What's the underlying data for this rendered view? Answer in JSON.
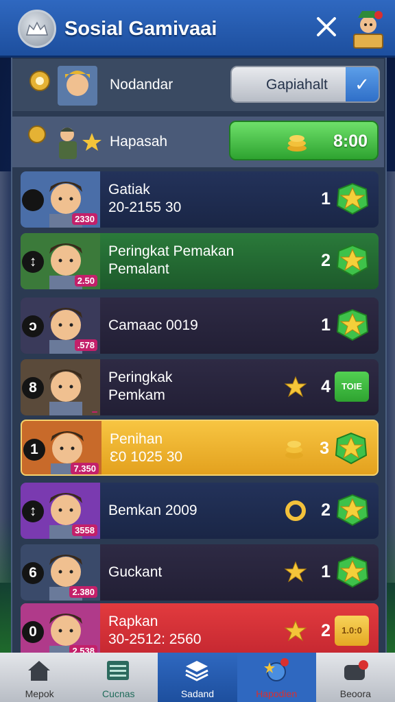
{
  "header": {
    "title": "Sosial Gamivaai"
  },
  "top_rows": [
    {
      "label": "Nodandar",
      "control_text": "Gapiahalt"
    },
    {
      "label": "Hapasah",
      "button_value": "8:00"
    }
  ],
  "rows": [
    {
      "name_line1": "Gatiak",
      "name_line2": "20-2155 30",
      "badge": "2330",
      "pos": "",
      "rank": "1",
      "style": "navy"
    },
    {
      "name_line1": "Peringkat Pemakan",
      "name_line2": "Pemalant",
      "badge": "2.50",
      "pos": "↕",
      "rank": "2",
      "style": "green"
    },
    {
      "name_line1": "Camaac 0019",
      "name_line2": "",
      "badge": ".578",
      "pos": "ↄ",
      "rank": "1",
      "style": "dark"
    },
    {
      "name_line1": "Peringkak",
      "name_line2": "Pemkam",
      "badge": "",
      "pos": "8",
      "rank": "4",
      "tag": "TOIE",
      "style": "dark"
    },
    {
      "name_line1": "Penihan",
      "name_line2": "Ɛ0 1025 30",
      "badge": "7.350",
      "pos": "1",
      "rank": "3",
      "style": "gold"
    },
    {
      "name_line1": "Bemkan 2009",
      "name_line2": "",
      "badge": "3558",
      "pos": "↕",
      "rank": "2",
      "style": "navy"
    },
    {
      "name_line1": "Guckant",
      "name_line2": "",
      "badge": "2.380",
      "pos": "6",
      "rank": "1",
      "style": "dark"
    },
    {
      "name_line1": "Rapkan",
      "name_line2": "30-2512: 2560",
      "badge": "2.538",
      "pos": "0",
      "rank": "2",
      "tag": "1.0:0",
      "style": "red"
    }
  ],
  "bottom_nav": [
    {
      "label": "Mepok",
      "icon": "home-icon"
    },
    {
      "label": "Cucnas",
      "icon": "list-icon"
    },
    {
      "label": "Sadand",
      "icon": "stack-icon"
    },
    {
      "label": "Hapodien",
      "icon": "globe-star-icon"
    },
    {
      "label": "Beoora",
      "icon": "card-icon"
    }
  ],
  "colors": {
    "header": "#2f68c0",
    "panel": "#2b3a52",
    "gold_row": "#f7c542",
    "red_row": "#e23b3e",
    "green_row": "#2a7a3a",
    "green_button": "#4cc64a"
  }
}
